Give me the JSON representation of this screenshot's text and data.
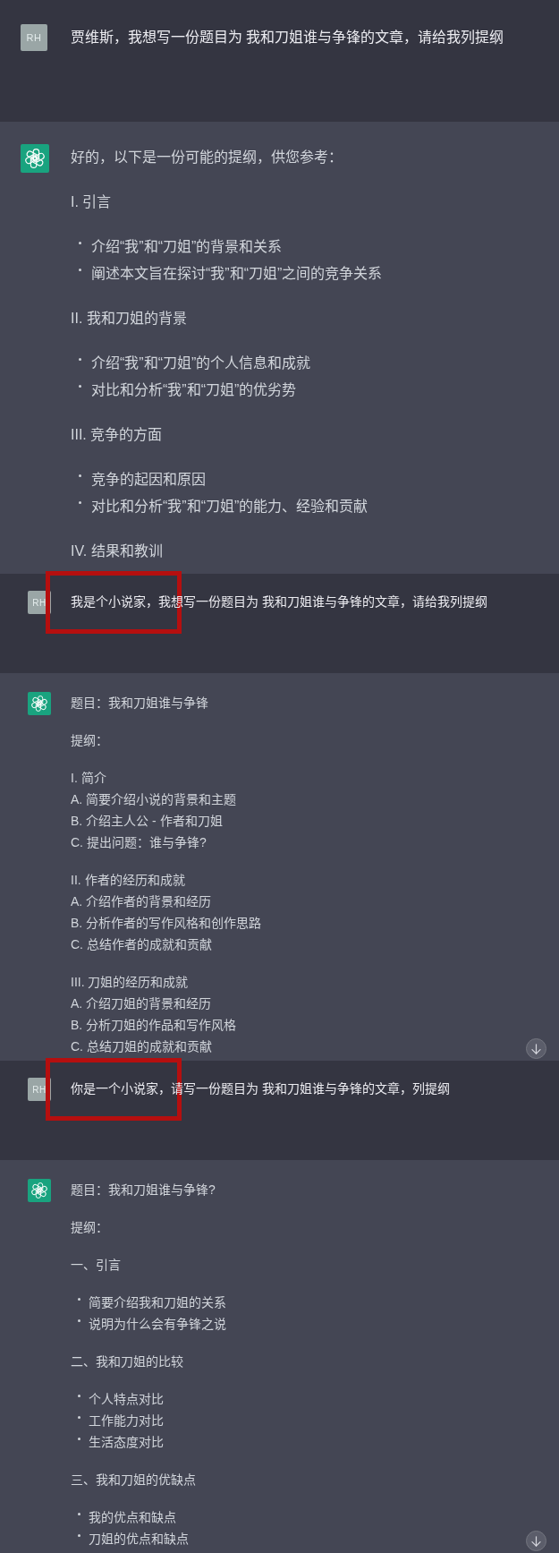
{
  "screenshots": [
    {
      "kind": "large",
      "messages": [
        {
          "kind": "user",
          "avatar": "RH",
          "text": "贾维斯，我想写一份题目为 我和刀姐谁与争锋的文章，请给我列提纲",
          "highlighted": false
        },
        {
          "kind": "assistant",
          "blocks": [
            {
              "kind": "paragraph",
              "text": "好的，以下是一份可能的提纲，供您参考："
            },
            {
              "kind": "heading",
              "text": "I. 引言"
            },
            {
              "kind": "bullets",
              "items": [
                "介绍“我”和“刀姐”的背景和关系",
                "阐述本文旨在探讨“我”和“刀姐”之间的竞争关系"
              ]
            },
            {
              "kind": "heading",
              "text": "II. 我和刀姐的背景"
            },
            {
              "kind": "bullets",
              "items": [
                "介绍“我”和“刀姐”的个人信息和成就",
                "对比和分析“我”和“刀姐”的优劣势"
              ]
            },
            {
              "kind": "heading",
              "text": "III. 竞争的方面"
            },
            {
              "kind": "bullets",
              "items": [
                "竞争的起因和原因",
                "对比和分析“我”和“刀姐”的能力、经验和贡献"
              ]
            },
            {
              "kind": "heading",
              "text": "IV. 结果和教训"
            }
          ]
        }
      ]
    },
    {
      "kind": "compact",
      "scroll_button": true,
      "messages": [
        {
          "kind": "user",
          "avatar": "RH",
          "text": "我是个小说家，我想写一份题目为 我和刀姐谁与争锋的文章，请给我列提纲",
          "highlighted": true
        },
        {
          "kind": "assistant",
          "blocks": [
            {
              "kind": "paragraph",
              "text": "题目：我和刀姐谁与争锋"
            },
            {
              "kind": "paragraph",
              "text": "提纲："
            },
            {
              "kind": "lines",
              "lines": [
                "I. 简介",
                "A. 简要介绍小说的背景和主题",
                "B. 介绍主人公 - 作者和刀姐",
                "C. 提出问题：谁与争锋?"
              ]
            },
            {
              "kind": "lines",
              "lines": [
                "II. 作者的经历和成就",
                "A. 介绍作者的背景和经历",
                "B. 分析作者的写作风格和创作思路",
                "C. 总结作者的成就和贡献"
              ]
            },
            {
              "kind": "lines",
              "lines": [
                "III. 刀姐的经历和成就",
                "A. 介绍刀姐的背景和经历",
                "B. 分析刀姐的作品和写作风格",
                "C. 总结刀姐的成就和贡献"
              ]
            }
          ]
        }
      ]
    },
    {
      "kind": "compact",
      "scroll_button": true,
      "messages": [
        {
          "kind": "user",
          "avatar": "RH",
          "text": "你是一个小说家，请写一份题目为 我和刀姐谁与争锋的文章，列提纲",
          "highlighted": true
        },
        {
          "kind": "assistant",
          "blocks": [
            {
              "kind": "paragraph",
              "text": "题目：我和刀姐谁与争锋?"
            },
            {
              "kind": "paragraph",
              "text": "提纲："
            },
            {
              "kind": "heading",
              "text": "一、引言"
            },
            {
              "kind": "bullets",
              "items": [
                "简要介绍我和刀姐的关系",
                "说明为什么会有争锋之说"
              ]
            },
            {
              "kind": "heading",
              "text": "二、我和刀姐的比较"
            },
            {
              "kind": "bullets",
              "items": [
                "个人特点对比",
                "工作能力对比",
                "生活态度对比"
              ]
            },
            {
              "kind": "heading",
              "text": "三、我和刀姐的优缺点"
            },
            {
              "kind": "bullets",
              "items": [
                "我的优点和缺点",
                "刀姐的优点和缺点"
              ]
            }
          ]
        }
      ]
    }
  ]
}
